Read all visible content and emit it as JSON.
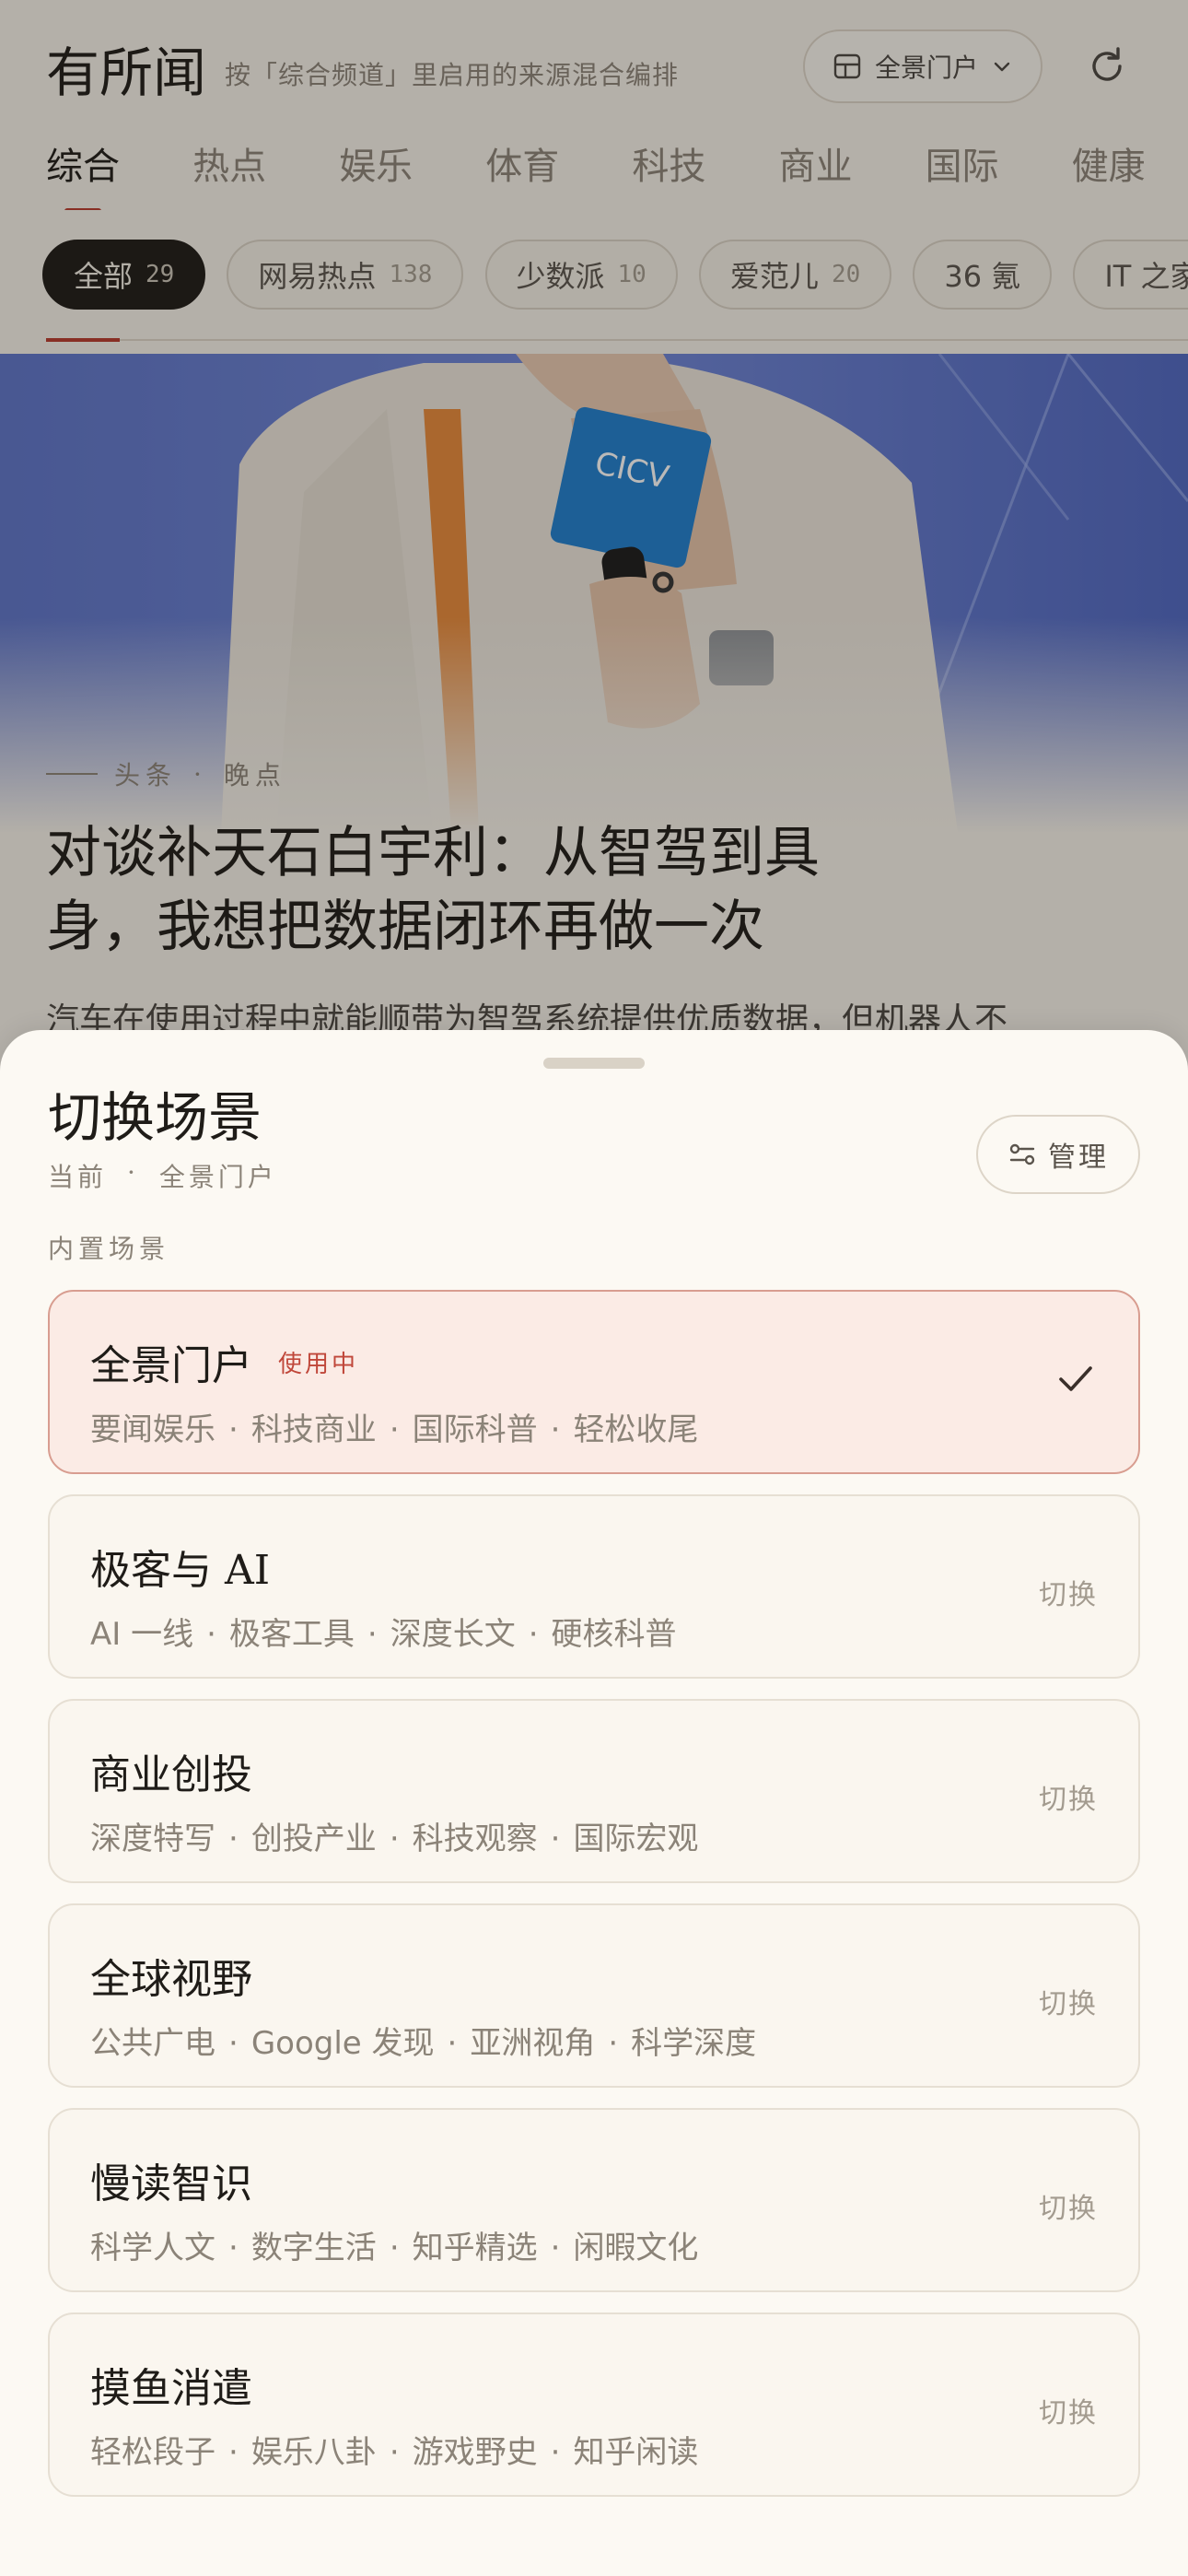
{
  "header": {
    "app_title": "有所闻",
    "subtitle": "按「综合频道」里启用的来源混合编排",
    "scene_pill_label": "全景门户"
  },
  "channel_tabs": [
    "综合",
    "热点",
    "娱乐",
    "体育",
    "科技",
    "商业",
    "国际",
    "健康"
  ],
  "source_chips": [
    {
      "label": "全部",
      "count": "29"
    },
    {
      "label": "网易热点",
      "count": "138"
    },
    {
      "label": "少数派",
      "count": "10"
    },
    {
      "label": "爱范儿",
      "count": "20"
    },
    {
      "label": "36 氪",
      "count": ""
    },
    {
      "label": "IT 之家",
      "count": ""
    }
  ],
  "hero": {
    "meta_left": "头条",
    "meta_right": "晚点",
    "title": "对谈补天石白宇利：从智驾到具身，我想把数据闭环再做一次",
    "summary": "汽车在使用过程中就能顺带为智驾系统提供优质数据，但机器人不"
  },
  "sheet": {
    "title": "切换场景",
    "current_label": "当前",
    "current_value": "全景门户",
    "manage_label": "管理",
    "section_label": "内置场景",
    "in_use_label": "使用中",
    "switch_label": "切换",
    "scenes": [
      {
        "name": "全景门户",
        "tags": [
          "要闻娱乐",
          "科技商业",
          "国际科普",
          "轻松收尾"
        ],
        "active": true
      },
      {
        "name": "极客与 AI",
        "tags": [
          "AI 一线",
          "极客工具",
          "深度长文",
          "硬核科普"
        ],
        "active": false
      },
      {
        "name": "商业创投",
        "tags": [
          "深度特写",
          "创投产业",
          "科技观察",
          "国际宏观"
        ],
        "active": false
      },
      {
        "name": "全球视野",
        "tags": [
          "公共广电",
          "Google 发现",
          "亚洲视角",
          "科学深度"
        ],
        "active": false
      },
      {
        "name": "慢读智识",
        "tags": [
          "科学人文",
          "数字生活",
          "知乎精选",
          "闲暇文化"
        ],
        "active": false
      },
      {
        "name": "摸鱼消遣",
        "tags": [
          "轻松段子",
          "娱乐八卦",
          "游戏野史",
          "知乎闲读"
        ],
        "active": false
      }
    ]
  },
  "colors": {
    "accent": "#b8392c",
    "active_card_bg": "#fbebe5",
    "background": "#f6f2ea"
  }
}
